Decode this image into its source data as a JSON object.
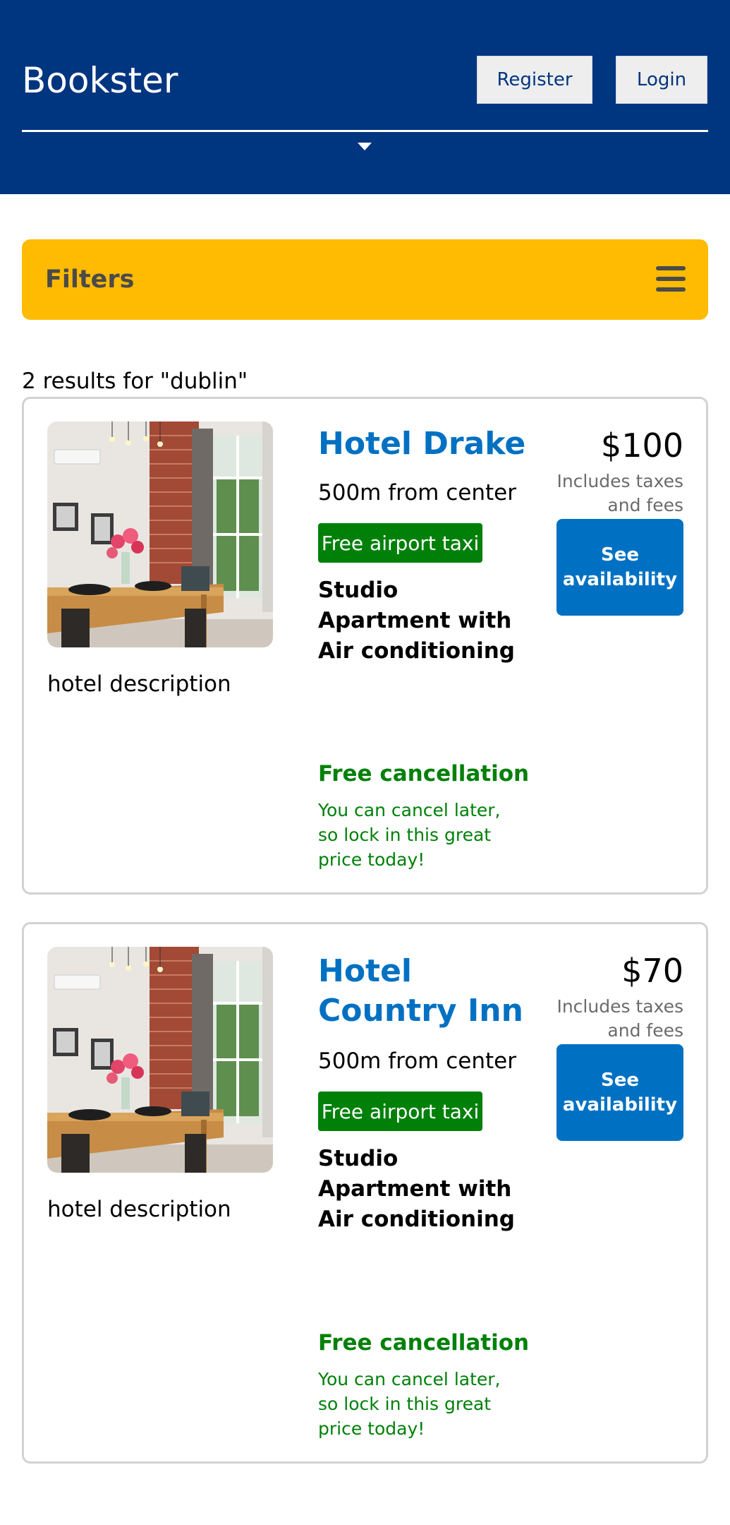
{
  "header": {
    "brand": "Bookster",
    "register_label": "Register",
    "login_label": "Login"
  },
  "filters": {
    "label": "Filters"
  },
  "results": {
    "summary": "2 results for \"dublin\""
  },
  "hotels": [
    {
      "name": "Hotel Drake",
      "distance": "500m from center",
      "badge": "Free airport taxi",
      "room": "Studio Apartment with Air conditioning",
      "description": "hotel description",
      "cancellation_title": "Free cancellation",
      "cancellation_text": "You can cancel later, so lock in this great price today!",
      "price": "$100",
      "price_note": "Includes taxes and fees",
      "cta": "See availability"
    },
    {
      "name": "Hotel Country Inn",
      "distance": "500m from center",
      "badge": "Free airport taxi",
      "room": "Studio Apartment with Air conditioning",
      "description": "hotel description",
      "cancellation_title": "Free cancellation",
      "cancellation_text": "You can cancel later, so lock in this great price today!",
      "price": "$70",
      "price_note": "Includes taxes and fees",
      "cta": "See availability"
    }
  ],
  "colors": {
    "header_bg": "#003580",
    "filters_bg": "#febb02",
    "link_blue": "#0071c2",
    "success_green": "#008009"
  },
  "icons": {
    "menu": "hamburger-menu-icon",
    "expand": "caret-down-icon"
  }
}
